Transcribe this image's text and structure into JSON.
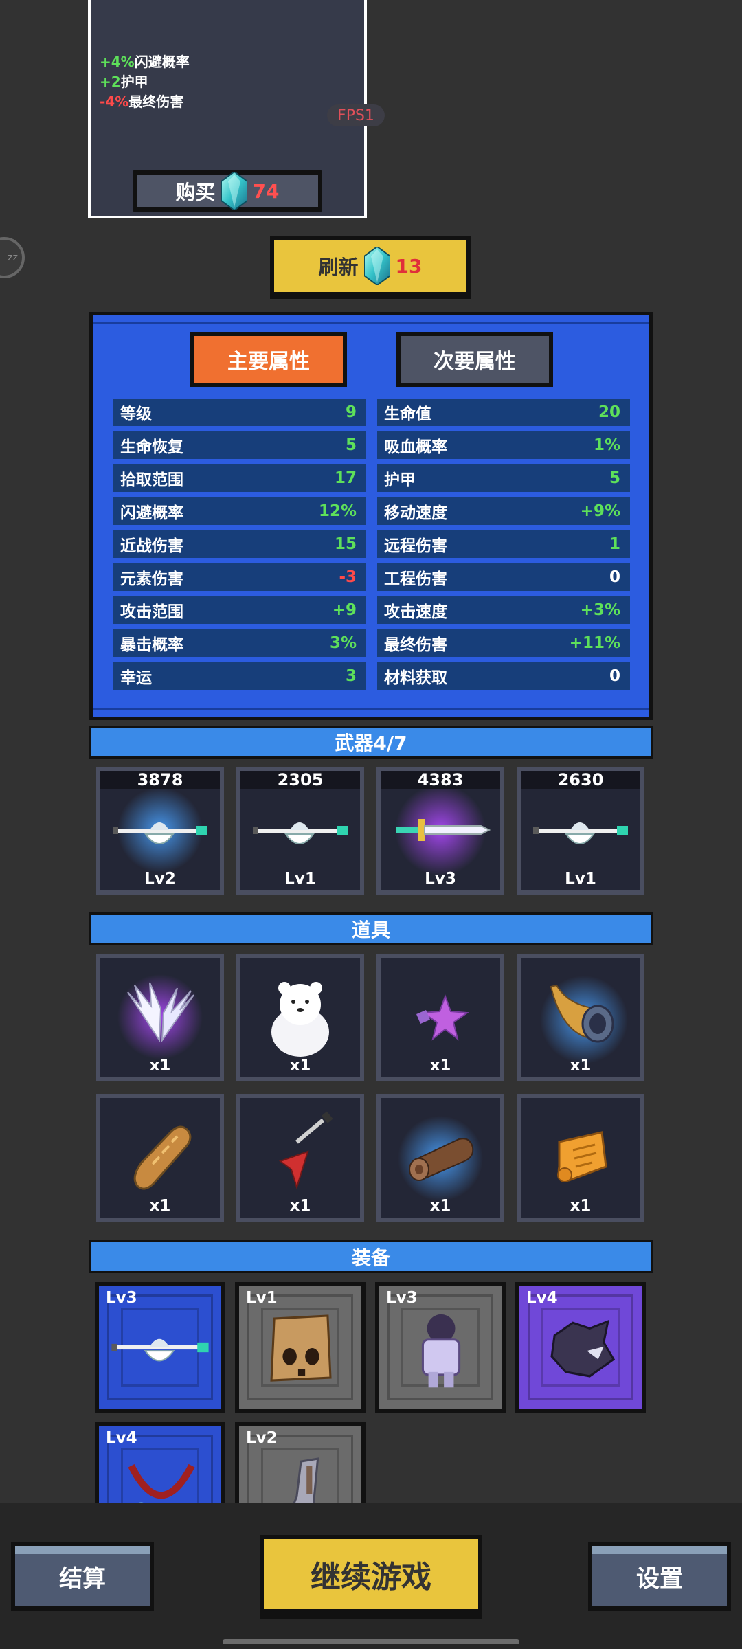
{
  "shop": {
    "mods": [
      {
        "value": "+4%",
        "label": "闪避概率",
        "negative": false
      },
      {
        "value": "+2",
        "label": "护甲",
        "negative": false
      },
      {
        "value": "-4%",
        "label": "最终伤害",
        "negative": true
      }
    ],
    "buy_label": "购买",
    "buy_price": "74"
  },
  "fps_label": "FPS1",
  "side_bubble": "zz",
  "refresh": {
    "label": "刷新",
    "price": "13"
  },
  "stats": {
    "tab_main": "主要属性",
    "tab_sub": "次要属性",
    "left": [
      {
        "label": "等级",
        "value": "9"
      },
      {
        "label": "生命恢复",
        "value": "5"
      },
      {
        "label": "拾取范围",
        "value": "17"
      },
      {
        "label": "闪避概率",
        "value": "12%"
      },
      {
        "label": "近战伤害",
        "value": "15"
      },
      {
        "label": "元素伤害",
        "value": "-3"
      },
      {
        "label": "攻击范围",
        "value": "+9"
      },
      {
        "label": "暴击概率",
        "value": "3%"
      },
      {
        "label": "幸运",
        "value": "3"
      }
    ],
    "right": [
      {
        "label": "生命值",
        "value": "20"
      },
      {
        "label": "吸血概率",
        "value": "1%"
      },
      {
        "label": "护甲",
        "value": "5"
      },
      {
        "label": "移动速度",
        "value": "+9%"
      },
      {
        "label": "远程伤害",
        "value": "1"
      },
      {
        "label": "工程伤害",
        "value": "0"
      },
      {
        "label": "攻击速度",
        "value": "+3%"
      },
      {
        "label": "最终伤害",
        "value": "+11%"
      },
      {
        "label": "材料获取",
        "value": "0"
      }
    ]
  },
  "weapons": {
    "title": "武器4/7",
    "items": [
      {
        "score": "3878",
        "level": "Lv2",
        "icon": "axe-icon"
      },
      {
        "score": "2305",
        "level": "Lv1",
        "icon": "axe-icon"
      },
      {
        "score": "4383",
        "level": "Lv3",
        "icon": "sword-icon"
      },
      {
        "score": "2630",
        "level": "Lv1",
        "icon": "axe-icon"
      }
    ]
  },
  "items": {
    "title": "道具",
    "list": [
      {
        "count": "x1",
        "icon": "wings-icon"
      },
      {
        "count": "x1",
        "icon": "polar-bear-icon"
      },
      {
        "count": "x1",
        "icon": "spiked-star-icon"
      },
      {
        "count": "x1",
        "icon": "horn-icon"
      },
      {
        "count": "x1",
        "icon": "bread-icon"
      },
      {
        "count": "x1",
        "icon": "guitar-icon"
      },
      {
        "count": "x1",
        "icon": "log-icon"
      },
      {
        "count": "x1",
        "icon": "scroll-icon"
      }
    ]
  },
  "equipment": {
    "title": "装备",
    "list": [
      {
        "level": "Lv3",
        "rarity": "blue",
        "icon": "axe-icon"
      },
      {
        "level": "Lv1",
        "rarity": "gray",
        "icon": "paper-bag-mask-icon"
      },
      {
        "level": "Lv3",
        "rarity": "gray",
        "icon": "ghost-knight-icon"
      },
      {
        "level": "Lv4",
        "rarity": "purple",
        "icon": "dark-creature-icon"
      },
      {
        "level": "Lv4",
        "rarity": "blue",
        "icon": "necklace-icon"
      },
      {
        "level": "Lv2",
        "rarity": "gray",
        "icon": "gauntlet-icon"
      }
    ]
  },
  "bottom": {
    "settle": "结算",
    "continue": "继续游戏",
    "settings": "设置"
  },
  "colors": {
    "positive": "#5ee05a",
    "negative": "#ff4a4a",
    "accent_yellow": "#e9c53d",
    "panel_blue": "#2c5ce0",
    "tab_orange": "#f07030"
  }
}
